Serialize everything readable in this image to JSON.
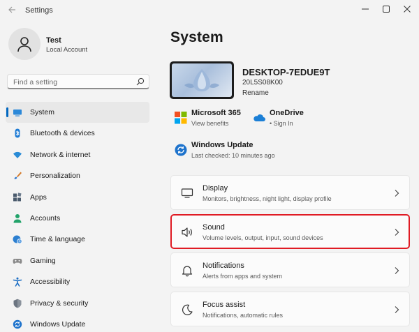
{
  "window": {
    "title": "Settings"
  },
  "profile": {
    "name": "Test",
    "account_type": "Local Account"
  },
  "search": {
    "placeholder": "Find a setting"
  },
  "sidebar": {
    "items": [
      {
        "label": "System",
        "icon": "system-icon",
        "active": true
      },
      {
        "label": "Bluetooth & devices",
        "icon": "bluetooth-icon"
      },
      {
        "label": "Network & internet",
        "icon": "wifi-icon"
      },
      {
        "label": "Personalization",
        "icon": "brush-icon"
      },
      {
        "label": "Apps",
        "icon": "apps-icon"
      },
      {
        "label": "Accounts",
        "icon": "person-icon"
      },
      {
        "label": "Time & language",
        "icon": "globe-clock-icon"
      },
      {
        "label": "Gaming",
        "icon": "gamepad-icon"
      },
      {
        "label": "Accessibility",
        "icon": "accessibility-icon"
      },
      {
        "label": "Privacy & security",
        "icon": "shield-icon"
      },
      {
        "label": "Windows Update",
        "icon": "update-icon"
      }
    ]
  },
  "main": {
    "title": "System",
    "device": {
      "name": "DESKTOP-7EDUE9T",
      "model": "20L5S08K00",
      "rename_label": "Rename"
    },
    "quick_links": [
      {
        "title": "Microsoft 365",
        "subtitle": "View benefits",
        "icon": "microsoft365-icon"
      },
      {
        "title": "OneDrive",
        "subtitle": "• Sign In",
        "icon": "onedrive-icon"
      },
      {
        "title": "Windows Update",
        "subtitle": "Last checked: 10 minutes ago",
        "icon": "windows-update-icon"
      }
    ],
    "cards": [
      {
        "title": "Display",
        "subtitle": "Monitors, brightness, night light, display profile",
        "icon": "display-icon"
      },
      {
        "title": "Sound",
        "subtitle": "Volume levels, output, input, sound devices",
        "icon": "speaker-icon",
        "highlighted": true
      },
      {
        "title": "Notifications",
        "subtitle": "Alerts from apps and system",
        "icon": "bell-icon"
      },
      {
        "title": "Focus assist",
        "subtitle": "Notifications, automatic rules",
        "icon": "moon-icon"
      }
    ]
  },
  "colors": {
    "accent": "#0067c0",
    "highlight_border": "#e01b24",
    "background": "#f3f3f3"
  }
}
